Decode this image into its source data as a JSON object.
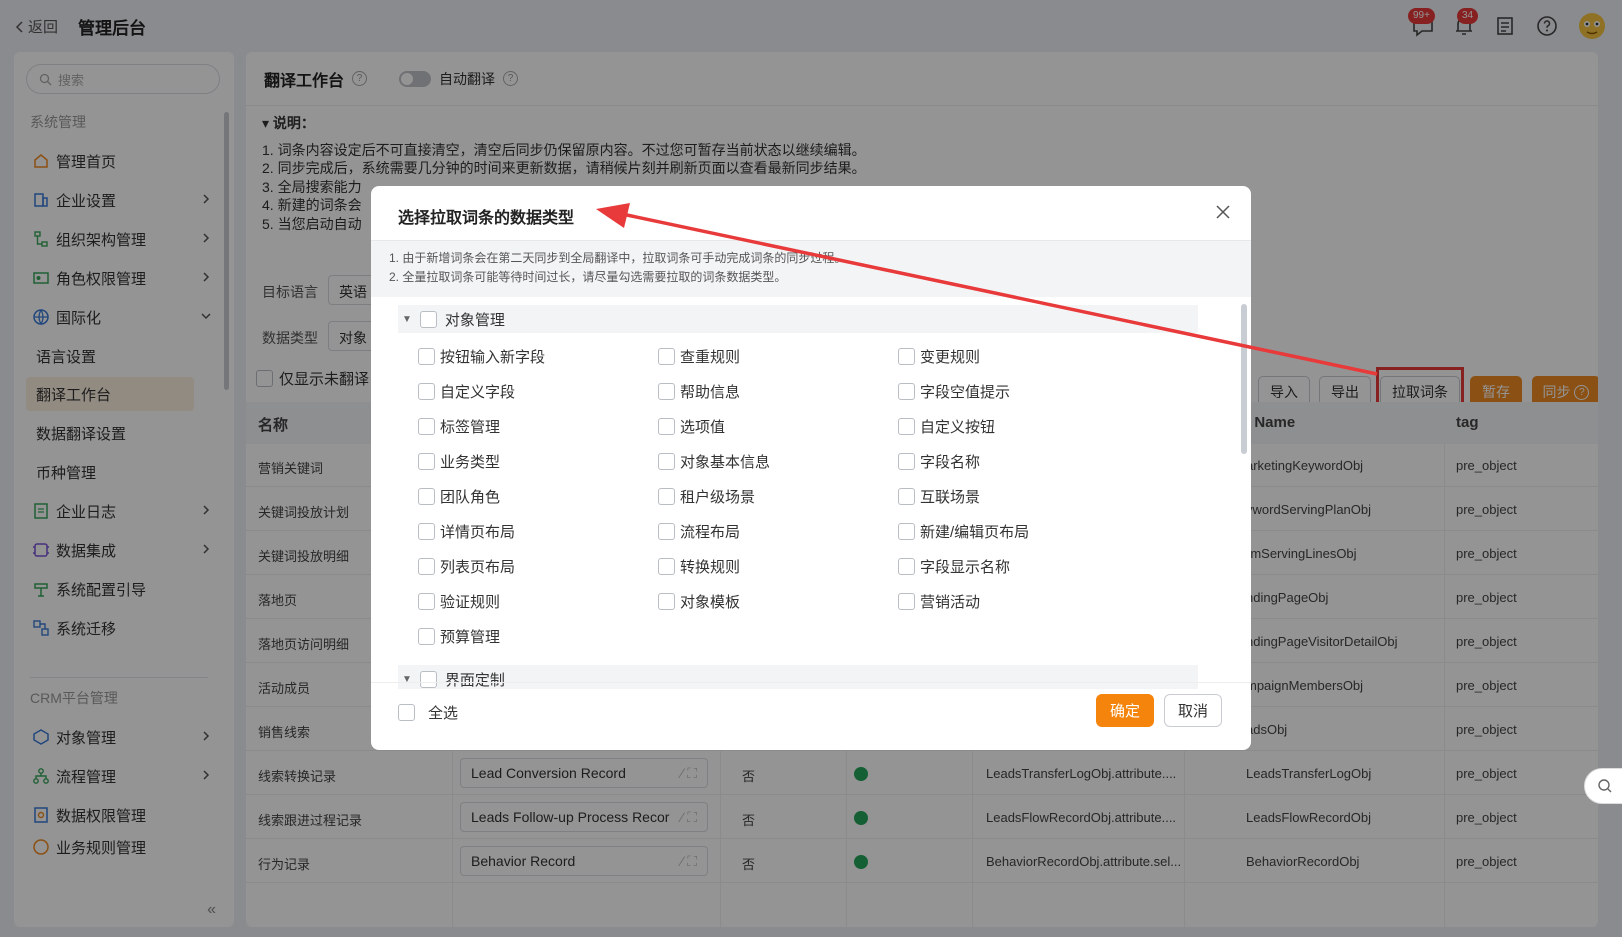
{
  "topbar": {
    "back": "返回",
    "title": "管理后台",
    "msg_badge": "99+",
    "bell_badge": "34"
  },
  "sidebar": {
    "search_placeholder": "搜索",
    "section1": "系统管理",
    "items": [
      {
        "label": "管理首页",
        "icon": "home-icon"
      },
      {
        "label": "企业设置",
        "icon": "building-icon"
      },
      {
        "label": "组织架构管理",
        "icon": "org-icon"
      },
      {
        "label": "角色权限管理",
        "icon": "id-card-icon"
      },
      {
        "label": "国际化",
        "icon": "globe-icon"
      }
    ],
    "subitems": [
      "语言设置",
      "翻译工作台",
      "数据翻译设置",
      "币种管理"
    ],
    "items2": [
      {
        "label": "企业日志",
        "icon": "log-icon"
      },
      {
        "label": "数据集成",
        "icon": "integration-icon"
      },
      {
        "label": "系统配置引导",
        "icon": "guide-icon"
      },
      {
        "label": "系统迁移",
        "icon": "migrate-icon"
      }
    ],
    "section2": "CRM平台管理",
    "items3": [
      {
        "label": "对象管理",
        "icon": "object-icon"
      },
      {
        "label": "流程管理",
        "icon": "flow-icon"
      },
      {
        "label": "数据权限管理",
        "icon": "data-permission-icon"
      },
      {
        "label": "业务规则管理",
        "icon": "rule-icon"
      }
    ]
  },
  "main": {
    "title": "翻译工作台",
    "auto_translate": "自动翻译",
    "notes_title": "说明：",
    "notes": [
      "1. 词条内容设定后不可直接清空，清空后同步仍保留原内容。不过您可暂存当前状态以继续编辑。",
      "2. 同步完成后，系统需要几分钟的时间来更新数据，请稍候片刻并刷新页面以查看最新同步结果。",
      "3. 全局搜索能力",
      "4. 新建的词条会",
      "5. 当您启动自动"
    ],
    "target_lang_label": "目标语言",
    "target_lang_value": "英语",
    "data_type_label": "数据类型",
    "data_type_value": "对象",
    "only_untranslated": "仅显示未翻译",
    "buttons": {
      "import": "导入",
      "export": "导出",
      "pull": "拉取词条",
      "save": "暂存",
      "sync": "同步"
    },
    "table": {
      "col_name": "名称",
      "col_api": "i Name",
      "col_tag": "tag",
      "rows": [
        {
          "name": "营销关键词",
          "api": "arketingKeywordObj",
          "tag": "pre_object"
        },
        {
          "name": "关键词投放计划",
          "api": "ywordServingPlanObj",
          "tag": "pre_object"
        },
        {
          "name": "关键词投放明细",
          "api": "rmServingLinesObj",
          "tag": "pre_object"
        },
        {
          "name": "落地页",
          "api": "ndingPageObj",
          "tag": "pre_object"
        },
        {
          "name": "落地页访问明细",
          "api": "ndingPageVisitorDetailObj",
          "tag": "pre_object"
        },
        {
          "name": "活动成员",
          "api": "mpaignMembersObj",
          "tag": "pre_object"
        },
        {
          "name": "销售线索",
          "api": "adsObj",
          "tag": "pre_object"
        },
        {
          "name": "线索转换记录",
          "value": "Lead Conversion Record",
          "flag": "否",
          "field": "LeadsTransferLogObj.attribute....",
          "api": "LeadsTransferLogObj",
          "tag": "pre_object"
        },
        {
          "name": "线索跟进过程记录",
          "value": "Leads Follow-up Process Recor",
          "flag": "否",
          "field": "LeadsFlowRecordObj.attribute....",
          "api": "LeadsFlowRecordObj",
          "tag": "pre_object"
        },
        {
          "name": "行为记录",
          "value": "Behavior Record",
          "flag": "否",
          "field": "BehaviorRecordObj.attribute.sel...",
          "api": "BehaviorRecordObj",
          "tag": "pre_object"
        }
      ]
    }
  },
  "modal": {
    "title": "选择拉取词条的数据类型",
    "tips": [
      "1. 由于新增词条会在第二天同步到全局翻译中，拉取词条可手动完成词条的同步过程。",
      "2. 全量拉取词条可能等待时间过长，请尽量勾选需要拉取的词条数据类型。"
    ],
    "group1": "对象管理",
    "options": [
      [
        "按钮输入新字段",
        "查重规则",
        "变更规则"
      ],
      [
        "自定义字段",
        "帮助信息",
        "字段空值提示"
      ],
      [
        "标签管理",
        "选项值",
        "自定义按钮"
      ],
      [
        "业务类型",
        "对象基本信息",
        "字段名称"
      ],
      [
        "团队角色",
        "租户级场景",
        "互联场景"
      ],
      [
        "详情页布局",
        "流程布局",
        "新建/编辑页布局"
      ],
      [
        "列表页布局",
        "转换规则",
        "字段显示名称"
      ],
      [
        "验证规则",
        "对象模板",
        "营销活动"
      ],
      [
        "预算管理"
      ]
    ],
    "group2": "界面定制",
    "select_all": "全选",
    "confirm": "确定",
    "cancel": "取消"
  },
  "colors": {
    "accent": "#f08a24",
    "highlight": "#e83a3a",
    "success": "#23a45a"
  }
}
